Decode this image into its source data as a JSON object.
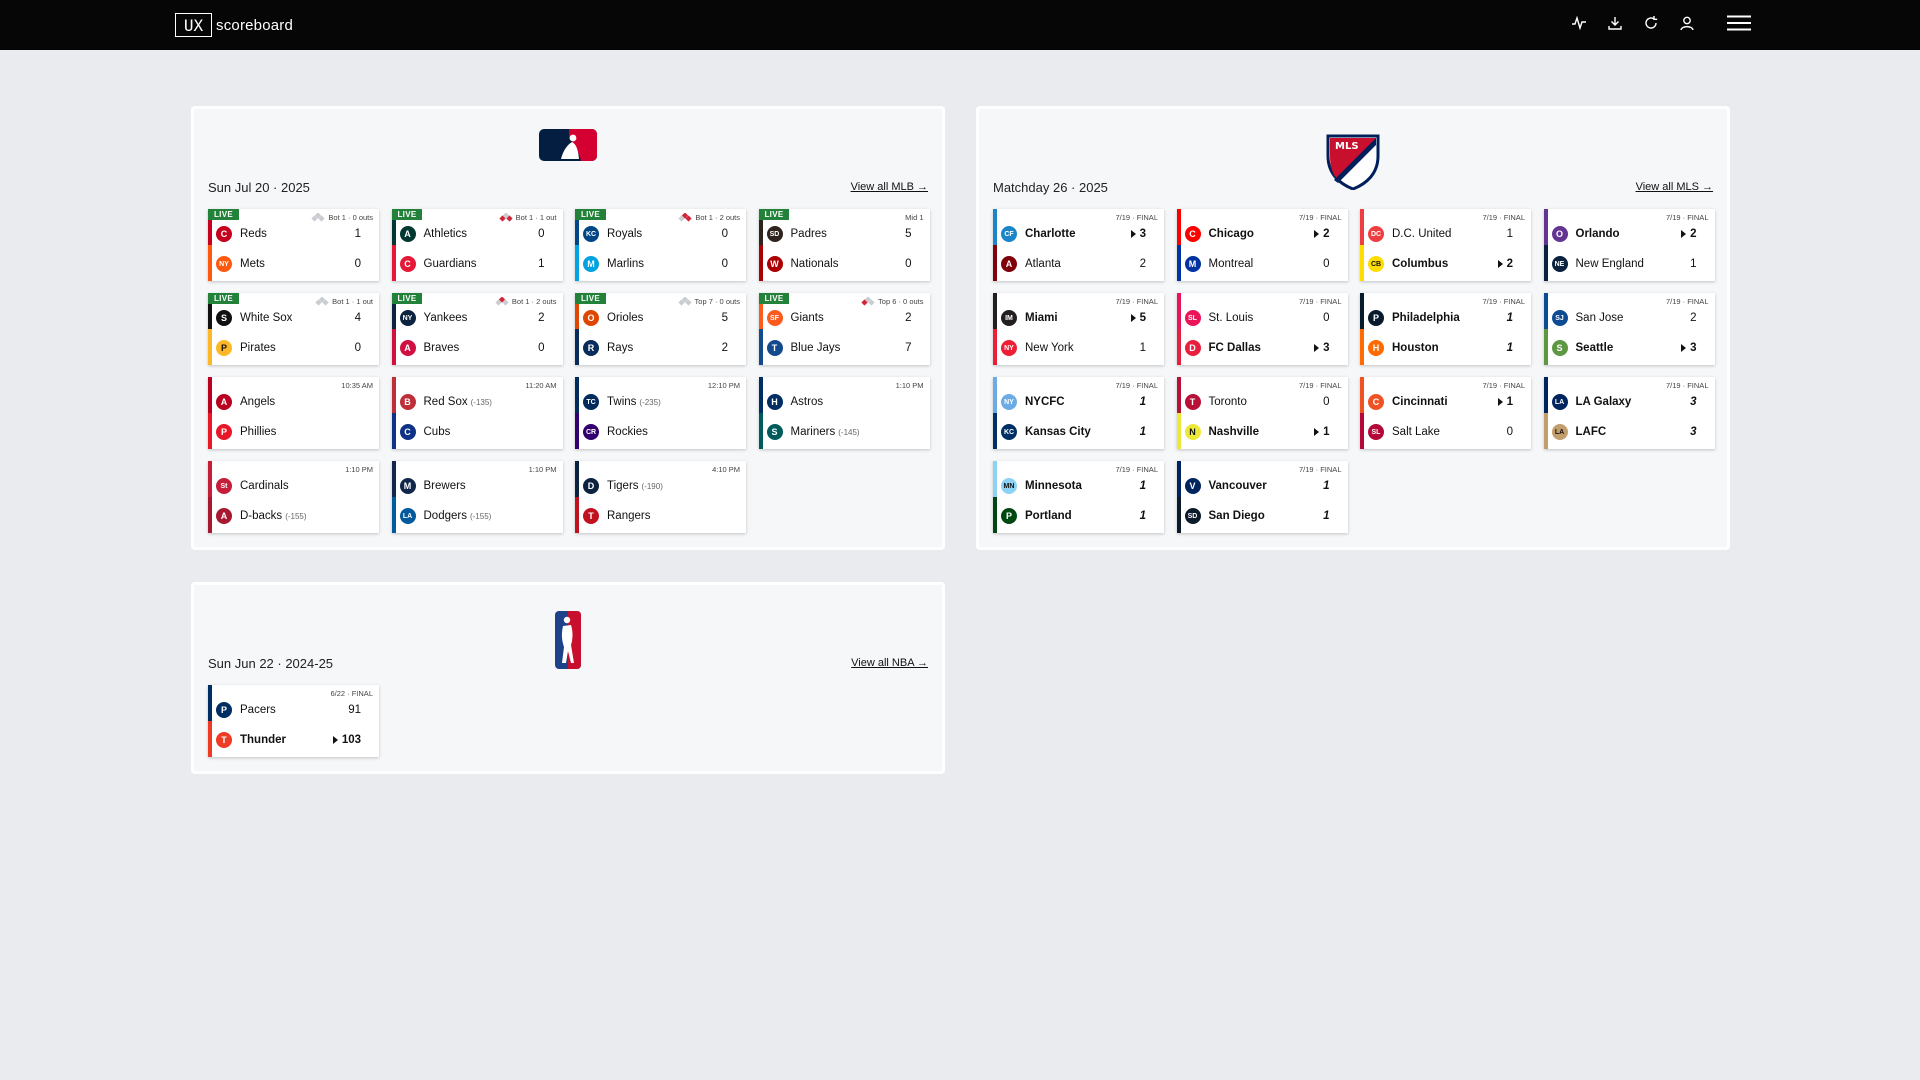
{
  "brand": {
    "box": "UX",
    "name": "scoreboard"
  },
  "topbar_icons": [
    "activity-icon",
    "download-icon",
    "refresh-icon",
    "user-icon"
  ],
  "mlb": {
    "logo": "mlb-logo",
    "date": "Sun Jul 20 · 2025",
    "view_all": "View all MLB →",
    "games": [
      {
        "live": "LIVE",
        "status": "Bot 1 · 0 outs",
        "bases": [
          0,
          0,
          0
        ],
        "t1": {
          "name": "Reds",
          "score": "1",
          "color": "#c6011f",
          "abbr": "C"
        },
        "t2": {
          "name": "Mets",
          "score": "0",
          "color": "#ff5910",
          "abbr": "NY"
        }
      },
      {
        "live": "LIVE",
        "status": "Bot 1 · 1 out",
        "bases": [
          1,
          0,
          1
        ],
        "t1": {
          "name": "Athletics",
          "score": "0",
          "color": "#003831",
          "abbr": "A"
        },
        "t2": {
          "name": "Guardians",
          "score": "1",
          "color": "#e31937",
          "abbr": "C"
        }
      },
      {
        "live": "LIVE",
        "status": "Bot 1 · 2 outs",
        "bases": [
          1,
          1,
          0
        ],
        "t1": {
          "name": "Royals",
          "score": "0",
          "color": "#004687",
          "abbr": "KC"
        },
        "t2": {
          "name": "Marlins",
          "score": "0",
          "color": "#00a3e0",
          "abbr": "M"
        }
      },
      {
        "live": "LIVE",
        "status": "Mid 1",
        "bases": null,
        "t1": {
          "name": "Padres",
          "score": "5",
          "color": "#2f241d",
          "abbr": "SD"
        },
        "t2": {
          "name": "Nationals",
          "score": "0",
          "color": "#ab0003",
          "abbr": "W"
        }
      },
      {
        "live": "LIVE",
        "status": "Bot 1 · 1 out",
        "bases": [
          0,
          0,
          0
        ],
        "t1": {
          "name": "White Sox",
          "score": "4",
          "color": "#111111",
          "abbr": "S"
        },
        "t2": {
          "name": "Pirates",
          "score": "0",
          "color": "#fdb827",
          "abbr": "P"
        }
      },
      {
        "live": "LIVE",
        "status": "Bot 1 · 2 outs",
        "bases": [
          0,
          1,
          0
        ],
        "t1": {
          "name": "Yankees",
          "score": "2",
          "color": "#0c2340",
          "abbr": "NY"
        },
        "t2": {
          "name": "Braves",
          "score": "0",
          "color": "#ce1141",
          "abbr": "A"
        }
      },
      {
        "live": "LIVE",
        "status": "Top 7 · 0 outs",
        "bases": [
          0,
          0,
          0
        ],
        "t1": {
          "name": "Orioles",
          "score": "5",
          "color": "#df4601",
          "abbr": "O"
        },
        "t2": {
          "name": "Rays",
          "score": "2",
          "color": "#092c5c",
          "abbr": "R"
        }
      },
      {
        "live": "LIVE",
        "status": "Top 6 · 0 outs",
        "bases": [
          0,
          0,
          1
        ],
        "t1": {
          "name": "Giants",
          "score": "2",
          "color": "#fd5a1e",
          "abbr": "SF"
        },
        "t2": {
          "name": "Blue Jays",
          "score": "7",
          "color": "#134a8e",
          "abbr": "T"
        }
      },
      {
        "live": "",
        "status": "10:35 AM",
        "bases": null,
        "t1": {
          "name": "Angels",
          "score": "",
          "color": "#ba0021",
          "abbr": "A"
        },
        "t2": {
          "name": "Phillies",
          "score": "",
          "color": "#e81828",
          "abbr": "P"
        }
      },
      {
        "live": "",
        "status": "11:20 AM",
        "bases": null,
        "t1": {
          "name": "Red Sox",
          "odds": "(-135)",
          "score": "",
          "color": "#bd3039",
          "abbr": "B"
        },
        "t2": {
          "name": "Cubs",
          "score": "",
          "color": "#0e3386",
          "abbr": "C"
        }
      },
      {
        "live": "",
        "status": "12:10 PM",
        "bases": null,
        "t1": {
          "name": "Twins",
          "odds": "(-235)",
          "score": "",
          "color": "#002b5c",
          "abbr": "TC"
        },
        "t2": {
          "name": "Rockies",
          "score": "",
          "color": "#33006f",
          "abbr": "CR"
        }
      },
      {
        "live": "",
        "status": "1:10 PM",
        "bases": null,
        "t1": {
          "name": "Astros",
          "score": "",
          "color": "#002d62",
          "abbr": "H"
        },
        "t2": {
          "name": "Mariners",
          "odds": "(-145)",
          "score": "",
          "color": "#005c5c",
          "abbr": "S"
        }
      },
      {
        "live": "",
        "status": "1:10 PM",
        "bases": null,
        "t1": {
          "name": "Cardinals",
          "score": "",
          "color": "#c41e3a",
          "abbr": "St"
        },
        "t2": {
          "name": "D-backs",
          "odds": "(-155)",
          "score": "",
          "color": "#a71930",
          "abbr": "A"
        }
      },
      {
        "live": "",
        "status": "1:10 PM",
        "bases": null,
        "t1": {
          "name": "Brewers",
          "score": "",
          "color": "#12284b",
          "abbr": "M"
        },
        "t2": {
          "name": "Dodgers",
          "odds": "(-155)",
          "score": "",
          "color": "#005a9c",
          "abbr": "LA"
        }
      },
      {
        "live": "",
        "status": "4:10 PM",
        "bases": null,
        "t1": {
          "name": "Tigers",
          "odds": "(-190)",
          "score": "",
          "color": "#0c2340",
          "abbr": "D"
        },
        "t2": {
          "name": "Rangers",
          "score": "",
          "color": "#c0111f",
          "abbr": "T"
        }
      }
    ]
  },
  "mls": {
    "logo": "mls-logo",
    "date": "Matchday 26 · 2025",
    "view_all": "View all MLS →",
    "games": [
      {
        "status": "7/19 · FINAL",
        "t1": {
          "name": "Charlotte",
          "score": "3",
          "win": true,
          "color": "#1a85c8",
          "abbr": "CF"
        },
        "t2": {
          "name": "Atlanta",
          "score": "2",
          "color": "#80000a",
          "abbr": "A"
        }
      },
      {
        "status": "7/19 · FINAL",
        "t1": {
          "name": "Chicago",
          "score": "2",
          "win": true,
          "color": "#ff0000",
          "abbr": "C"
        },
        "t2": {
          "name": "Montreal",
          "score": "0",
          "color": "#0033a1",
          "abbr": "M"
        }
      },
      {
        "status": "7/19 · FINAL",
        "t1": {
          "name": "D.C. United",
          "score": "1",
          "color": "#ef3e42",
          "abbr": "DC"
        },
        "t2": {
          "name": "Columbus",
          "score": "2",
          "win": true,
          "color": "#fedd00",
          "abbr": "CB"
        }
      },
      {
        "status": "7/19 · FINAL",
        "t1": {
          "name": "Orlando",
          "score": "2",
          "win": true,
          "color": "#633492",
          "abbr": "O"
        },
        "t2": {
          "name": "New England",
          "score": "1",
          "color": "#0a2240",
          "abbr": "NE"
        }
      },
      {
        "status": "7/19 · FINAL",
        "t1": {
          "name": "Miami",
          "score": "5",
          "win": true,
          "color": "#231f20",
          "abbr": "IM"
        },
        "t2": {
          "name": "New York",
          "score": "1",
          "color": "#ed1e36",
          "abbr": "NY"
        }
      },
      {
        "status": "7/19 · FINAL",
        "t1": {
          "name": "St. Louis",
          "score": "0",
          "color": "#ec1458",
          "abbr": "SL"
        },
        "t2": {
          "name": "FC Dallas",
          "score": "3",
          "win": true,
          "color": "#e81f3e",
          "abbr": "D"
        }
      },
      {
        "status": "7/19 · FINAL",
        "t1": {
          "name": "Philadelphia",
          "score": "1",
          "tie": true,
          "color": "#071b2c",
          "abbr": "P"
        },
        "t2": {
          "name": "Houston",
          "score": "1",
          "tie": true,
          "color": "#ff6b00",
          "abbr": "H"
        }
      },
      {
        "status": "7/19 · FINAL",
        "t1": {
          "name": "San Jose",
          "score": "2",
          "color": "#0d4c92",
          "abbr": "SJ"
        },
        "t2": {
          "name": "Seattle",
          "score": "3",
          "win": true,
          "color": "#5d9741",
          "abbr": "S"
        }
      },
      {
        "status": "7/19 · FINAL",
        "t1": {
          "name": "NYCFC",
          "score": "1",
          "tie": true,
          "color": "#6cace4",
          "abbr": "NY"
        },
        "t2": {
          "name": "Kansas City",
          "score": "1",
          "tie": true,
          "color": "#002f65",
          "abbr": "KC"
        }
      },
      {
        "status": "7/19 · FINAL",
        "t1": {
          "name": "Toronto",
          "score": "0",
          "color": "#b81137",
          "abbr": "T"
        },
        "t2": {
          "name": "Nashville",
          "score": "1",
          "win": true,
          "color": "#ece83a",
          "abbr": "N"
        }
      },
      {
        "status": "7/19 · FINAL",
        "t1": {
          "name": "Cincinnati",
          "score": "1",
          "win": true,
          "color": "#f05323",
          "abbr": "C"
        },
        "t2": {
          "name": "Salt Lake",
          "score": "0",
          "color": "#b30838",
          "abbr": "SL"
        }
      },
      {
        "status": "7/19 · FINAL",
        "t1": {
          "name": "LA Galaxy",
          "score": "3",
          "tie": true,
          "color": "#00245d",
          "abbr": "LA"
        },
        "t2": {
          "name": "LAFC",
          "score": "3",
          "tie": true,
          "color": "#c39e6d",
          "abbr": "LA"
        }
      },
      {
        "status": "7/19 · FINAL",
        "t1": {
          "name": "Minnesota",
          "score": "1",
          "tie": true,
          "color": "#8cd2f4",
          "abbr": "MN"
        },
        "t2": {
          "name": "Portland",
          "score": "1",
          "tie": true,
          "color": "#004812",
          "abbr": "P"
        }
      },
      {
        "status": "7/19 · FINAL",
        "t1": {
          "name": "Vancouver",
          "score": "1",
          "tie": true,
          "color": "#00245e",
          "abbr": "V"
        },
        "t2": {
          "name": "San Diego",
          "score": "1",
          "tie": true,
          "color": "#0b1b2c",
          "abbr": "SD"
        }
      }
    ]
  },
  "nba": {
    "logo": "nba-logo",
    "date": "Sun Jun 22 · 2024-25",
    "view_all": "View all NBA →",
    "games": [
      {
        "status": "6/22 · FINAL",
        "t1": {
          "name": "Pacers",
          "score": "91",
          "color": "#002d62",
          "abbr": "P"
        },
        "t2": {
          "name": "Thunder",
          "score": "103",
          "win": true,
          "color": "#ef3b24",
          "abbr": "T"
        }
      }
    ]
  }
}
